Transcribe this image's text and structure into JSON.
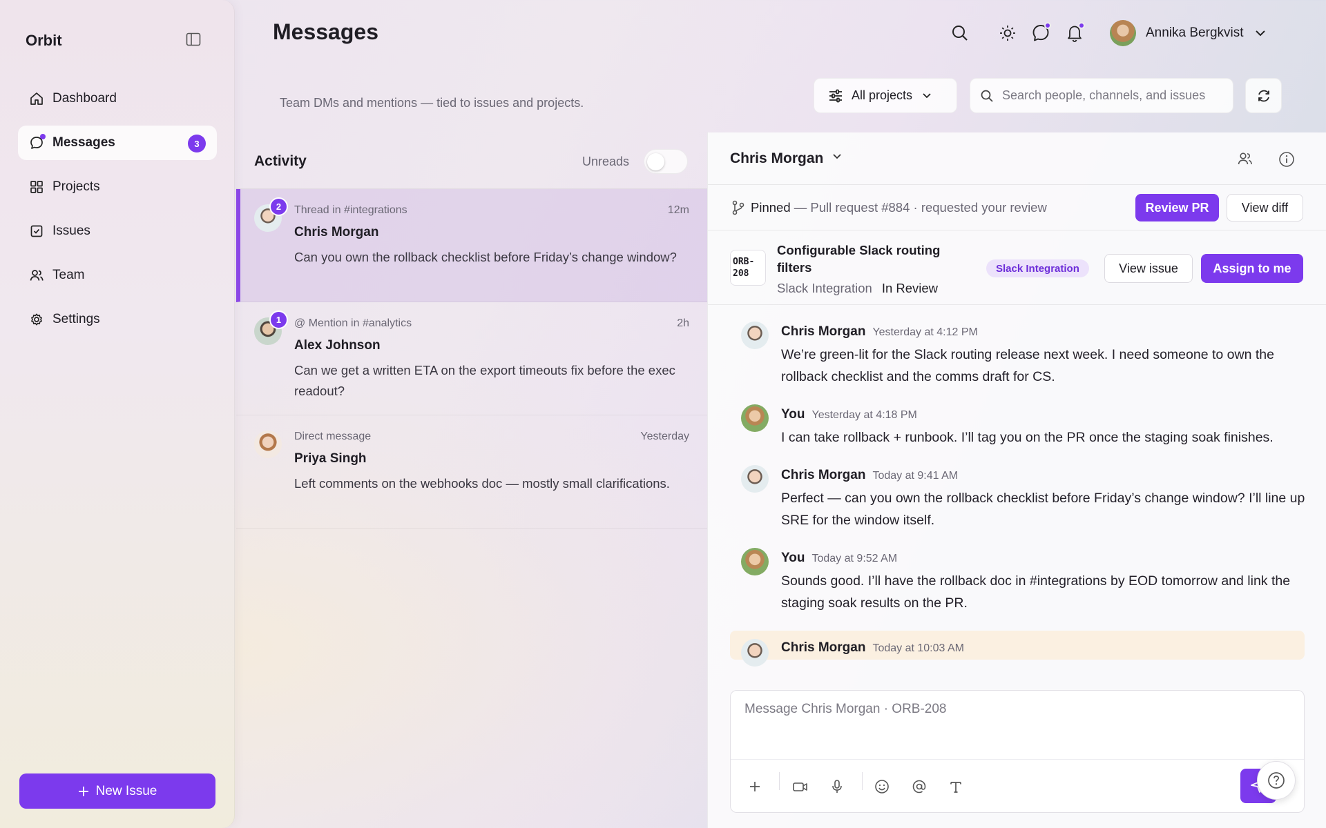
{
  "app": {
    "brand": "Orbit"
  },
  "sidebar": {
    "items": [
      {
        "label": "Dashboard",
        "icon": "home-icon"
      },
      {
        "label": "Messages",
        "icon": "chat-icon",
        "badge": "3",
        "active": true
      },
      {
        "label": "Projects",
        "icon": "grid-icon"
      },
      {
        "label": "Issues",
        "icon": "checkbox-icon"
      },
      {
        "label": "Team",
        "icon": "users-icon"
      },
      {
        "label": "Settings",
        "icon": "gear-icon"
      }
    ],
    "new_issue_label": "New Issue"
  },
  "header": {
    "title": "Messages",
    "subtitle": "Team DMs and mentions — tied to issues and projects.",
    "user_name": "Annika Bergkvist",
    "project_filter": "All projects",
    "search_placeholder": "Search people, channels, and issues"
  },
  "activity": {
    "title": "Activity",
    "unreads_label": "Unreads",
    "unreads_on": false,
    "threads": [
      {
        "context": "Thread in #integrations",
        "time": "12m",
        "name": "Chris Morgan",
        "preview": "Can you own the rollback checklist before Friday’s change window?",
        "badge": "2",
        "active": true
      },
      {
        "context": "@ Mention in #analytics",
        "time": "2h",
        "name": "Alex Johnson",
        "preview": "Can we get a written ETA on the export timeouts fix before the exec readout?",
        "badge": "1"
      },
      {
        "context": "Direct message",
        "time": "Yesterday",
        "name": "Priya Singh",
        "preview": "Left comments on the webhooks doc — mostly small clarifications."
      }
    ]
  },
  "conversation": {
    "name": "Chris Morgan",
    "pinned": {
      "label": "Pinned",
      "text": "— Pull request #884 · requested your review",
      "review_label": "Review PR",
      "diff_label": "View diff"
    },
    "issue": {
      "id": "ORB-208",
      "id_line1": "ORB-",
      "id_line2": "208",
      "title": "Configurable Slack routing filters",
      "project": "Slack Integration",
      "status": "In Review",
      "tag": "Slack Integration",
      "view_label": "View issue",
      "assign_label": "Assign to me"
    },
    "messages": [
      {
        "name": "Chris Morgan",
        "time": "Yesterday at 4:12 PM",
        "text": "We’re green-lit for the Slack routing release next week. I need someone to own the rollback checklist and the comms draft for CS."
      },
      {
        "name": "You",
        "time": "Yesterday at 4:18 PM",
        "text": "I can take rollback + runbook. I’ll tag you on the PR once the staging soak finishes."
      },
      {
        "name": "Chris Morgan",
        "time": "Today at 9:41 AM",
        "text": "Perfect — can you own the rollback checklist before Friday’s change window? I’ll line up SRE for the window itself."
      },
      {
        "name": "You",
        "time": "Today at 9:52 AM",
        "text": "Sounds good. I’ll have the rollback doc in #integrations by EOD tomorrow and link the staging soak results on the PR."
      },
      {
        "name": "Chris Morgan",
        "time": "Today at 10:03 AM",
        "text": ""
      }
    ],
    "composer_placeholder": "Message Chris Morgan · ORB-208"
  },
  "colors": {
    "accent": "#7c3aed",
    "tag_bg": "#ece2fb",
    "highlight": "#fbf0e1"
  }
}
